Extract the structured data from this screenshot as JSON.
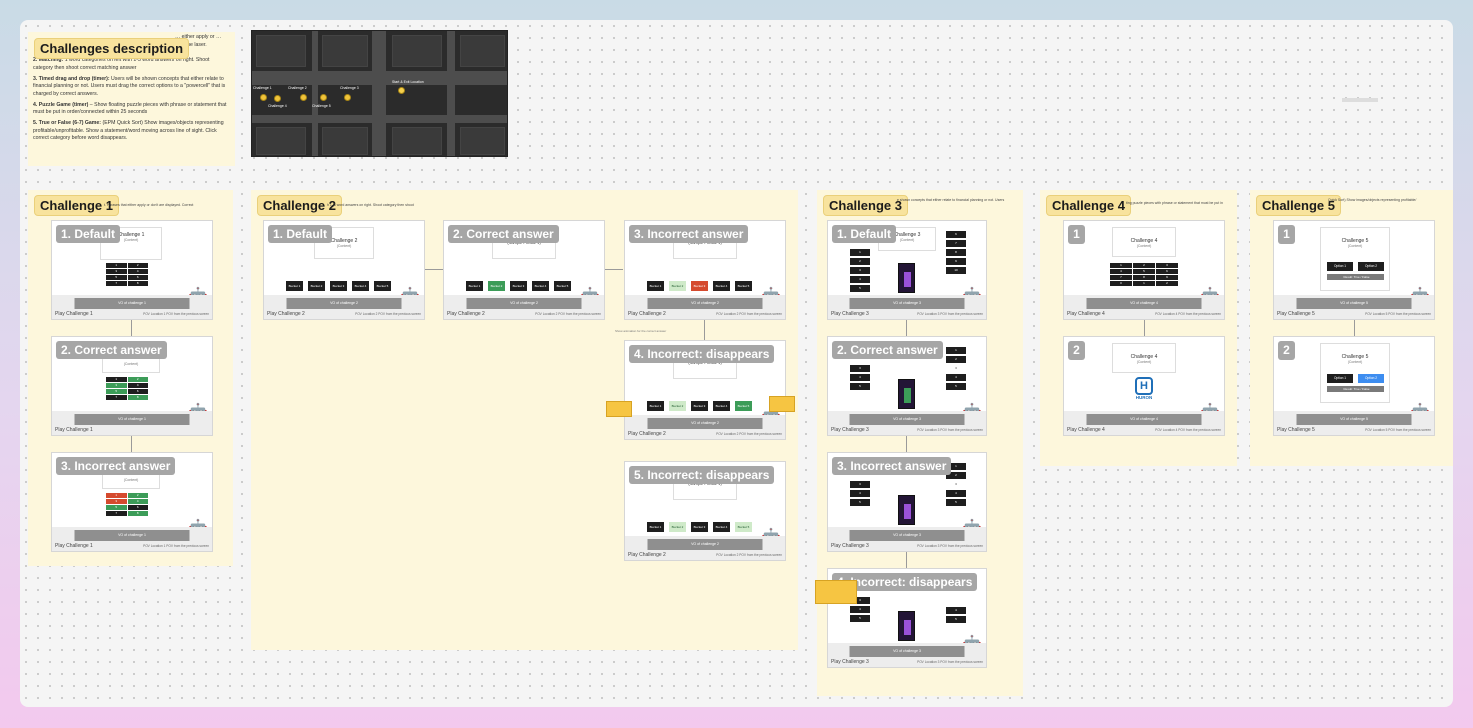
{
  "overview": {
    "title": "Challenges description",
    "desc_items": [
      {
        "bold": "",
        "text": "… either apply or … with the laser."
      },
      {
        "bold": "2. Matching:",
        "text": " 1 word categories on left with 1-3 word answers on right. Shoot category then shoot correct matching answer"
      },
      {
        "bold": "3. Timed drag and drop (timer):",
        "text": " Users will be shown concepts that either relate to financial planning or not. Users must drag the correct options to a \"powercell\" that is charged by correct answers."
      },
      {
        "bold": "4. Puzzle Game (timer)",
        "text": " – Show floating puzzle pieces with phrase or statement that must be put in order/connected within 25 seconds"
      },
      {
        "bold": "5. True or False (6-7) Game:",
        "text": " (EPM Quick Sort) Show images/objects representing profitable/unprofitable. Show a statement/word moving across line of sight. Click correct category before word disappears."
      }
    ],
    "map_labels": [
      "Challenge 1",
      "Challenge 2",
      "Challenge 3",
      "Challenge 4",
      "Challenge 5",
      "Start & Exit Location"
    ]
  },
  "sections": {
    "c1": {
      "title": "Challenge 1",
      "desc": "t. Phrases that either apply or don't are displayed. Correct"
    },
    "c2": {
      "title": "Challenge 2",
      "desc": "h 1–3 word answers on right. Shoot category then shoot"
    },
    "c3": {
      "title": "Challenge 3",
      "desc": "e shown concepts that either relate to financial planning or not. Users"
    },
    "c4": {
      "title": "Challenge 4",
      "desc": "ting puzzle pieces with phrase or statement that must be put in"
    },
    "c5": {
      "title": "Challenge 5",
      "desc": "Quick Sort) Show images/objects representing profitable/"
    }
  },
  "common": {
    "pov": "POV Location 1 POV from the previous screen",
    "pov2": "POV Location 2 POV from the previous screen",
    "pov3": "POV Location 3 POV from the previous screen",
    "pov4": "POV Location 4 POV from the previous screen",
    "pov5": "POV Location 5 POV from the previous screen",
    "content": "(Content)"
  },
  "c1_frames": [
    {
      "tag": "1. Default",
      "card": "Challenge 1",
      "vo": "VO of challenge 1",
      "play": "Play Challenge 1"
    },
    {
      "tag": "2. Correct answer",
      "vo": "VO of challenge 1",
      "play": "Play Challenge 1"
    },
    {
      "tag": "3. Incorrect answer",
      "vo": "VO of challenge 1",
      "play": "Play Challenge 1"
    }
  ],
  "c2_frames": [
    {
      "tag": "1. Default",
      "card": "Challenge 2",
      "vo": "VO of challenge 2",
      "play": "Play Challenge 2"
    },
    {
      "tag": "2. Correct answer",
      "card": "(Sample Phrase 1)",
      "vo": "VO of challenge 2",
      "play": "Play Challenge 2"
    },
    {
      "tag": "3. Incorrect answer",
      "card": "(Sample Phrase 1)",
      "vo": "VO of challenge 2",
      "play": "Play Challenge 2"
    },
    {
      "tag": "4. Incorrect: disappears",
      "card": "(Sample Phrase 1)",
      "vo": "VO of challenge 2",
      "play": "Play Challenge 2"
    },
    {
      "tag": "5. Incorrect: disappears",
      "card": "(Sample Phrase 1)",
      "vo": "VO of challenge 2",
      "play": "Play Challenge 2"
    }
  ],
  "c2_misc": {
    "anim_note": "Show animation for the correct answer",
    "buckets": [
      "Bucket 1",
      "Bucket 2",
      "Bucket 3",
      "Bucket 4",
      "Bucket 5"
    ]
  },
  "c3_frames": [
    {
      "tag": "1. Default",
      "card": "Challenge 3",
      "vo": "VO of challenge 3",
      "play": "Play Challenge 3"
    },
    {
      "tag": "2. Correct answer",
      "vo": "VO of challenge 3",
      "play": "Play Challenge 3"
    },
    {
      "tag": "3. Incorrect answer",
      "vo": "VO of challenge 3",
      "play": "Play Challenge 3"
    },
    {
      "tag": "4. Incorrect: disappears",
      "vo": "VO of challenge 3",
      "play": "Play Challenge 3"
    }
  ],
  "c4_frames": [
    {
      "tag": "1",
      "card": "Challenge 4",
      "vo": "VO of challenge 4",
      "play": "Play Challenge 4"
    },
    {
      "tag": "2",
      "card": "Challenge 4",
      "logo": "HURON",
      "vo": "VO of challenge 4",
      "play": "Play Challenge 4"
    }
  ],
  "c5_frames": [
    {
      "tag": "1",
      "card": "Challenge 5",
      "opt1": "Option 1",
      "opt2": "Option 2",
      "result": "Result: True / False",
      "vo": "VO of challenge 5",
      "play": "Play Challenge 5"
    },
    {
      "tag": "2",
      "card": "Challenge 5",
      "opt1": "Option 1",
      "opt2": "Option 2",
      "result": "Result: True / False",
      "vo": "VO of challenge 5",
      "play": "Play Challenge 5"
    }
  ]
}
